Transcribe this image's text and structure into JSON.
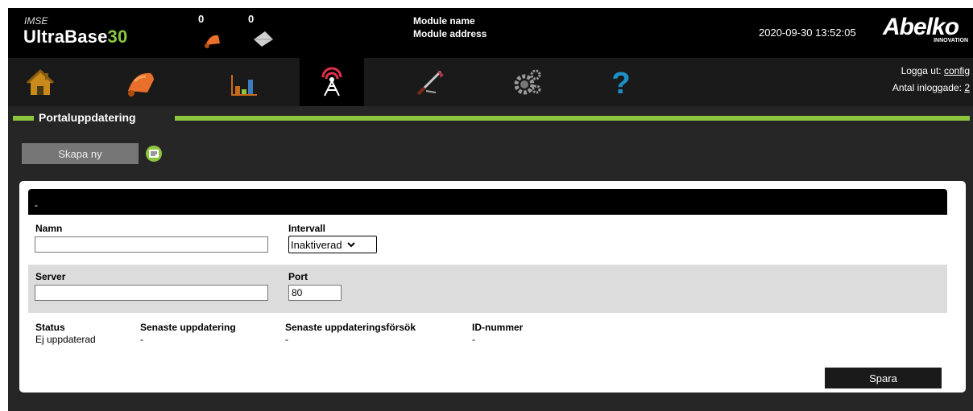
{
  "header": {
    "brand_small": "IMSE",
    "brand_prefix": "UltraBase",
    "brand_suffix": "30",
    "alarm_count": "0",
    "message_count": "0",
    "module_name": "Module name",
    "module_address": "Module address",
    "datetime": "2020-09-30 13:52:05",
    "logo_word": "Abelko",
    "logo_sub": "INNOVATION"
  },
  "nav": {
    "items": [
      "home-icon",
      "alarm-bell-icon",
      "chart-icon",
      "antenna-icon",
      "tools-icon",
      "settings-gears-icon",
      "help-icon"
    ],
    "active": "antenna-icon"
  },
  "user": {
    "logout_label": "Logga ut:",
    "user_name": "config",
    "logged_in_label": "Antal inloggade:",
    "logged_in_count": "2"
  },
  "section": {
    "title": "Portaluppdatering"
  },
  "toolbar": {
    "create_label": "Skapa ny"
  },
  "form": {
    "header_text": "-",
    "name_label": "Namn",
    "name_value": "",
    "interval_label": "Intervall",
    "interval_value": "Inaktiverad",
    "server_label": "Server",
    "server_value": "",
    "port_label": "Port",
    "port_value": "80",
    "status_label": "Status",
    "status_value": "Ej uppdaterad",
    "last_update_label": "Senaste uppdatering",
    "last_update_value": "-",
    "last_attempt_label": "Senaste uppdateringsförsök",
    "last_attempt_value": "-",
    "id_label": "ID-nummer",
    "id_value": "-",
    "save_label": "Spara"
  },
  "colors": {
    "accent": "#8cc63f",
    "alarm": "#e8702a",
    "help": "#1e90c8"
  }
}
